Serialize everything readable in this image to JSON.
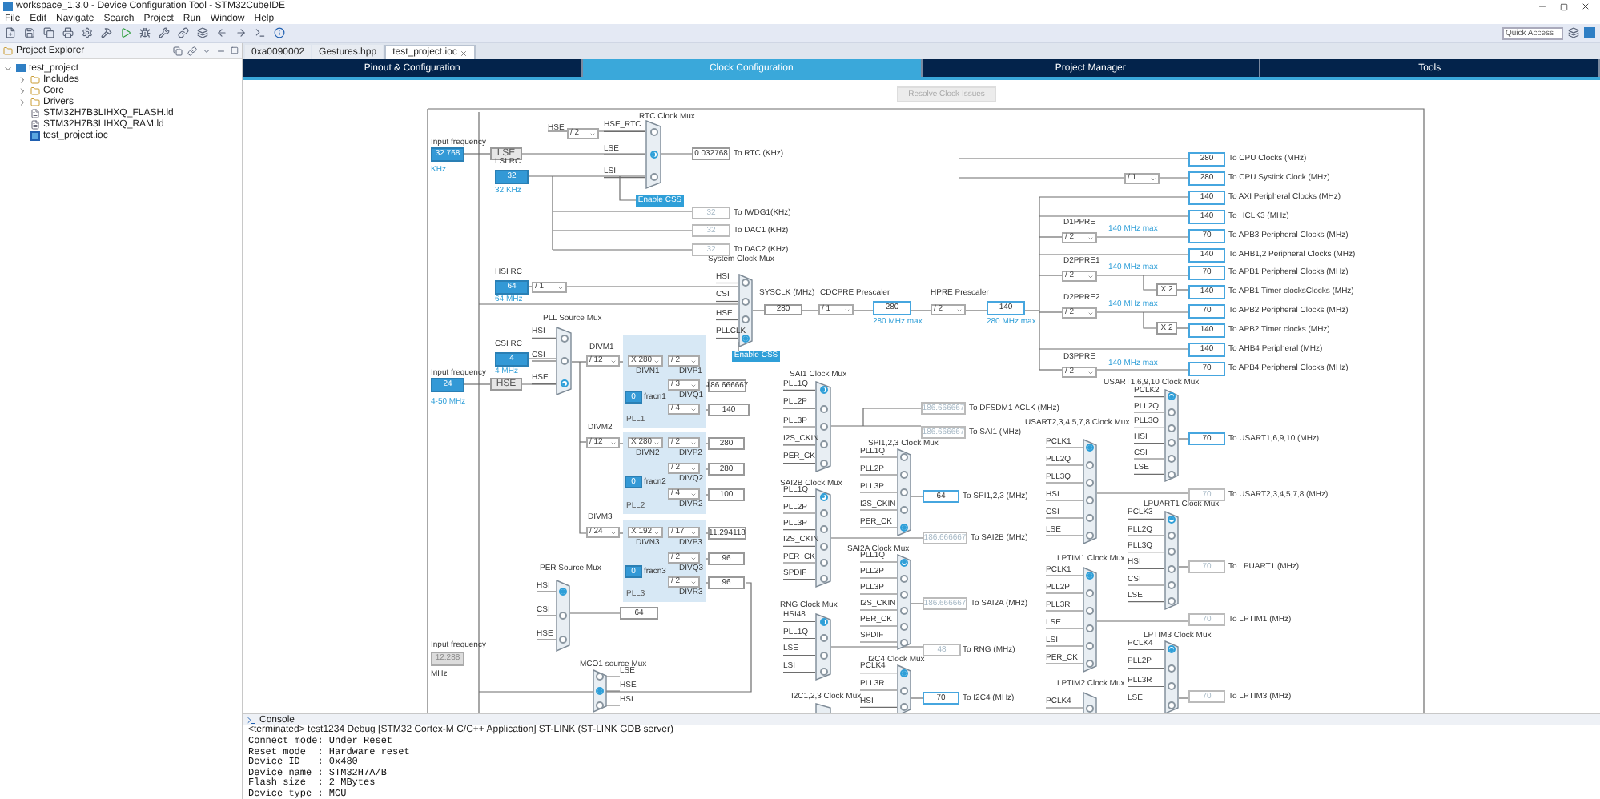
{
  "window": {
    "title": "workspace_1.3.0 - Device Configuration Tool - STM32CubeIDE"
  },
  "menu": [
    "File",
    "Edit",
    "Navigate",
    "Search",
    "Project",
    "Run",
    "Window",
    "Help"
  ],
  "quick_access": {
    "placeholder": "Quick Access"
  },
  "explorer": {
    "title": "Project Explorer",
    "tree": [
      {
        "label": "test_project",
        "kind": "project",
        "expanded": true,
        "children": [
          {
            "label": "Includes",
            "kind": "folder",
            "expanded": false
          },
          {
            "label": "Core",
            "kind": "folder",
            "expanded": false
          },
          {
            "label": "Drivers",
            "kind": "folder",
            "expanded": false
          },
          {
            "label": "STM32H7B3LIHXQ_FLASH.ld",
            "kind": "file"
          },
          {
            "label": "STM32H7B3LIHXQ_RAM.ld",
            "kind": "file"
          },
          {
            "label": "test_project.ioc",
            "kind": "ioc"
          }
        ]
      }
    ]
  },
  "editor_tabs": [
    {
      "label": "0xa0090002",
      "selected": false
    },
    {
      "label": "Gestures.hpp",
      "selected": false
    },
    {
      "label": "test_project.ioc",
      "selected": true
    }
  ],
  "config_tabs": [
    {
      "label": "Pinout & Configuration",
      "selected": false
    },
    {
      "label": "Clock Configuration",
      "selected": true
    },
    {
      "label": "Project Manager",
      "selected": false
    },
    {
      "label": "Tools",
      "selected": false
    }
  ],
  "resolve_button": {
    "label": "Resolve Clock Issues",
    "disabled": true
  },
  "diagram": {
    "items": [
      {
        "kind": "label",
        "text": "Input frequency"
      },
      {
        "kind": "input",
        "text": "32.768"
      },
      {
        "kind": "caption",
        "text": "KHz"
      },
      {
        "kind": "fixed",
        "text": "LSE"
      },
      {
        "kind": "label",
        "text": "LSI RC"
      },
      {
        "kind": "input",
        "text": "32"
      },
      {
        "kind": "caption",
        "text": "32 KHz"
      },
      {
        "kind": "label",
        "text": "HSE"
      },
      {
        "kind": "select",
        "text": "/ 2"
      },
      {
        "kind": "plain",
        "text": "0.032768"
      },
      {
        "kind": "label",
        "text": "To RTC (KHz)"
      },
      {
        "kind": "button",
        "text": "Enable CSS"
      },
      {
        "kind": "dim",
        "text": "32"
      },
      {
        "kind": "label",
        "text": "To IWDG1(KHz)"
      },
      {
        "kind": "dim",
        "text": "32"
      },
      {
        "kind": "label",
        "text": "To DAC1 (KHz)"
      },
      {
        "kind": "dim",
        "text": "32"
      },
      {
        "kind": "label",
        "text": "To DAC2 (KHz)"
      },
      {
        "kind": "label",
        "text": "HSI RC"
      },
      {
        "kind": "input",
        "text": "64"
      },
      {
        "kind": "caption",
        "text": "64 MHz"
      },
      {
        "kind": "select",
        "text": "/ 1"
      },
      {
        "kind": "label",
        "text": "SYSCLK (MHz)"
      },
      {
        "kind": "plain",
        "text": "280"
      },
      {
        "kind": "label",
        "text": "CDCPRE Prescaler"
      },
      {
        "kind": "select",
        "text": "/ 1"
      },
      {
        "kind": "output",
        "text": "280"
      },
      {
        "kind": "caption",
        "text": "280 MHz max"
      },
      {
        "kind": "label",
        "text": "HPRE Prescaler"
      },
      {
        "kind": "select",
        "text": "/ 2"
      },
      {
        "kind": "output",
        "text": "140"
      },
      {
        "kind": "caption",
        "text": "280 MHz max"
      },
      {
        "kind": "button",
        "text": "Enable CSS"
      },
      {
        "kind": "label",
        "text": "CSI RC"
      },
      {
        "kind": "input",
        "text": "4"
      },
      {
        "kind": "label",
        "text": "Input frequency"
      },
      {
        "kind": "caption",
        "text": "4 MHz"
      },
      {
        "kind": "input",
        "text": "24"
      },
      {
        "kind": "caption",
        "text": "4-50 MHz"
      },
      {
        "kind": "fixed",
        "text": "HSE"
      },
      {
        "kind": "panel",
        "text": "PLL1"
      },
      {
        "kind": "panel",
        "text": "PLL2"
      },
      {
        "kind": "panel",
        "text": "PLL3"
      },
      {
        "kind": "label",
        "text": "DIVM1"
      },
      {
        "kind": "select",
        "text": "/ 12"
      },
      {
        "kind": "select",
        "text": "X 280"
      },
      {
        "kind": "label",
        "text": "DIVN1"
      },
      {
        "kind": "select",
        "text": "/ 2"
      },
      {
        "kind": "label",
        "text": "DIVP1"
      },
      {
        "kind": "select",
        "text": "/ 3"
      },
      {
        "kind": "label",
        "text": "DIVQ1"
      },
      {
        "kind": "plain",
        "text": "186.666667"
      },
      {
        "kind": "input",
        "text": "0"
      },
      {
        "kind": "label",
        "text": "fracn1"
      },
      {
        "kind": "select",
        "text": "/ 4"
      },
      {
        "kind": "plain",
        "text": "140"
      },
      {
        "kind": "label",
        "text": "DIVM2"
      },
      {
        "kind": "select",
        "text": "/ 12"
      },
      {
        "kind": "select",
        "text": "X 280"
      },
      {
        "kind": "label",
        "text": "DIVN2"
      },
      {
        "kind": "select",
        "text": "/ 2"
      },
      {
        "kind": "label",
        "text": "DIVP2"
      },
      {
        "kind": "plain",
        "text": "280"
      },
      {
        "kind": "select",
        "text": "/ 2"
      },
      {
        "kind": "label",
        "text": "DIVQ2"
      },
      {
        "kind": "plain",
        "text": "280"
      },
      {
        "kind": "input",
        "text": "0"
      },
      {
        "kind": "label",
        "text": "fracn2"
      },
      {
        "kind": "select",
        "text": "/ 4"
      },
      {
        "kind": "label",
        "text": "DIVR2"
      },
      {
        "kind": "plain",
        "text": "100"
      },
      {
        "kind": "label",
        "text": "DIVM3"
      },
      {
        "kind": "select",
        "text": "/ 24"
      },
      {
        "kind": "select",
        "text": "X 192"
      },
      {
        "kind": "label",
        "text": "DIVN3"
      },
      {
        "kind": "select",
        "text": "/ 17"
      },
      {
        "kind": "label",
        "text": "DIVP3"
      },
      {
        "kind": "plain",
        "text": "11.294118"
      },
      {
        "kind": "select",
        "text": "/ 2"
      },
      {
        "kind": "label",
        "text": "DIVQ3"
      },
      {
        "kind": "plain",
        "text": "96"
      },
      {
        "kind": "input",
        "text": "0"
      },
      {
        "kind": "label",
        "text": "fracn3"
      },
      {
        "kind": "select",
        "text": "/ 2"
      },
      {
        "kind": "label",
        "text": "DIVR3"
      },
      {
        "kind": "plain",
        "text": "96"
      },
      {
        "kind": "plain",
        "text": "64"
      },
      {
        "kind": "label",
        "text": "Input frequency"
      },
      {
        "kind": "dimInput",
        "text": "12.288"
      },
      {
        "kind": "label",
        "text": "MHz"
      },
      {
        "kind": "dim",
        "text": "186.666667"
      },
      {
        "kind": "label",
        "text": "To DFSDM1 ACLK (MHz)"
      },
      {
        "kind": "dim",
        "text": "186.666667"
      },
      {
        "kind": "label",
        "text": "To SAI1 (MHz)"
      },
      {
        "kind": "output",
        "text": "64"
      },
      {
        "kind": "label",
        "text": "To SPI1,2,3 (MHz)"
      },
      {
        "kind": "dim",
        "text": "186.666667"
      },
      {
        "kind": "label",
        "text": "To SAI2B (MHz)"
      },
      {
        "kind": "dim",
        "text": "186.666667"
      },
      {
        "kind": "label",
        "text": "To SAI2A (MHz)"
      },
      {
        "kind": "dim",
        "text": "48"
      },
      {
        "kind": "label",
        "text": "To RNG (MHz)"
      },
      {
        "kind": "output",
        "text": "70"
      },
      {
        "kind": "label",
        "text": "To I2C4 (MHz)"
      },
      {
        "kind": "output",
        "text": "70"
      },
      {
        "kind": "label",
        "text": "To USART1,6,9,10 (MHz)"
      },
      {
        "kind": "dim",
        "text": "70"
      },
      {
        "kind": "label",
        "text": "To USART2,3,4,5,7,8 (MHz)"
      },
      {
        "kind": "dim",
        "text": "70"
      },
      {
        "kind": "label",
        "text": "To LPUART1 (MHz)"
      },
      {
        "kind": "dim",
        "text": "70"
      },
      {
        "kind": "label",
        "text": "To LPTIM1 (MHz)"
      },
      {
        "kind": "dim",
        "text": "70"
      },
      {
        "kind": "label",
        "text": "To LPTIM3 (MHz)"
      },
      {
        "kind": "output",
        "text": "280"
      },
      {
        "kind": "label",
        "text": "To CPU Clocks (MHz)"
      },
      {
        "kind": "output",
        "text": "280"
      },
      {
        "kind": "label",
        "text": "To CPU Systick Clock (MHz)"
      },
      {
        "kind": "output",
        "text": "140"
      },
      {
        "kind": "label",
        "text": "To AXI Peripheral Clocks (MHz)"
      },
      {
        "kind": "output",
        "text": "140"
      },
      {
        "kind": "label",
        "text": "To HCLK3 (MHz)"
      },
      {
        "kind": "output",
        "text": "70"
      },
      {
        "kind": "label",
        "text": "To APB3 Peripheral Clocks (MHz)"
      },
      {
        "kind": "output",
        "text": "140"
      },
      {
        "kind": "label",
        "text": "To AHB1,2 Peripheral Clocks (MHz)"
      },
      {
        "kind": "output",
        "text": "70"
      },
      {
        "kind": "label",
        "text": "To APB1 Peripheral Clocks (MHz)"
      },
      {
        "kind": "output",
        "text": "140"
      },
      {
        "kind": "label",
        "text": "To APB1 Timer clocksClocks (MHz)"
      },
      {
        "kind": "output",
        "text": "70"
      },
      {
        "kind": "label",
        "text": "To APB2 Peripheral Clocks (MHz)"
      },
      {
        "kind": "output",
        "text": "140"
      },
      {
        "kind": "label",
        "text": "To APB2 Timer clocks (MHz)"
      },
      {
        "kind": "output",
        "text": "140"
      },
      {
        "kind": "label",
        "text": "To AHB4 Peripheral (MHz)"
      },
      {
        "kind": "output",
        "text": "70"
      },
      {
        "kind": "label",
        "text": "To APB4 Peripheral Clocks (MHz)"
      },
      {
        "kind": "select",
        "text": "/ 1"
      },
      {
        "kind": "label",
        "text": "D1PPRE"
      },
      {
        "kind": "select",
        "text": "/ 2"
      },
      {
        "kind": "caption",
        "text": "140 MHz max"
      },
      {
        "kind": "label",
        "text": "D2PPRE1"
      },
      {
        "kind": "select",
        "text": "/ 2"
      },
      {
        "kind": "caption",
        "text": "140 MHz max"
      },
      {
        "kind": "label",
        "text": "D2PPRE2"
      },
      {
        "kind": "select",
        "text": "/ 2"
      },
      {
        "kind": "caption",
        "text": "140 MHz max"
      },
      {
        "kind": "label",
        "text": "D3PPRE"
      },
      {
        "kind": "select",
        "text": "/ 2"
      },
      {
        "kind": "caption",
        "text": "140 MHz max"
      },
      {
        "kind": "plain",
        "text": "X 2"
      },
      {
        "kind": "plain",
        "text": "X 2"
      }
    ],
    "muxes": [
      {
        "title": "RTC Clock Mux",
        "inputs": [
          {
            "label": "HSE_RTC",
            "selected": false
          },
          {
            "label": "LSE",
            "selected": true
          },
          {
            "label": "LSI",
            "selected": false
          }
        ]
      },
      {
        "title": "System Clock Mux",
        "inputs": [
          {
            "label": "HSI",
            "selected": false
          },
          {
            "label": "CSI",
            "selected": false
          },
          {
            "label": "HSE",
            "selected": false
          },
          {
            "label": "PLLCLK",
            "selected": true
          }
        ]
      },
      {
        "title": "PLL Source Mux",
        "inputs": [
          {
            "label": "HSI",
            "selected": false
          },
          {
            "label": "CSI",
            "selected": false
          },
          {
            "label": "HSE",
            "selected": true
          }
        ]
      },
      {
        "title": "PER Source Mux",
        "inputs": [
          {
            "label": "HSI",
            "selected": true
          },
          {
            "label": "CSI",
            "selected": false
          },
          {
            "label": "HSE",
            "selected": false
          }
        ]
      },
      {
        "title": "MCO1 source Mux",
        "inputs": [
          {
            "label": "LSE",
            "selected": false
          },
          {
            "label": "HSE",
            "selected": true
          },
          {
            "label": "HSI",
            "selected": false
          }
        ]
      },
      {
        "title": "SAI1 Clock Mux",
        "inputs": [
          {
            "label": "PLL1Q",
            "selected": true
          },
          {
            "label": "PLL2P",
            "selected": false
          },
          {
            "label": "PLL3P",
            "selected": false
          },
          {
            "label": "I2S_CKIN",
            "selected": false
          },
          {
            "label": "PER_CK",
            "selected": false
          }
        ]
      },
      {
        "title": "SPI1,2,3 Clock Mux",
        "inputs": [
          {
            "label": "PLL1Q",
            "selected": false
          },
          {
            "label": "PLL2P",
            "selected": false
          },
          {
            "label": "PLL3P",
            "selected": false
          },
          {
            "label": "I2S_CKIN",
            "selected": false
          },
          {
            "label": "PER_CK",
            "selected": true
          }
        ]
      },
      {
        "title": "SAI2B Clock Mux",
        "inputs": [
          {
            "label": "PLL1Q",
            "selected": true
          },
          {
            "label": "PLL2P",
            "selected": false
          },
          {
            "label": "PLL3P",
            "selected": false
          },
          {
            "label": "I2S_CKIN",
            "selected": false
          },
          {
            "label": "PER_CK",
            "selected": false
          },
          {
            "label": "SPDIF",
            "selected": false
          }
        ]
      },
      {
        "title": "SAI2A Clock Mux",
        "inputs": [
          {
            "label": "PLL1Q",
            "selected": true
          },
          {
            "label": "PLL2P",
            "selected": false
          },
          {
            "label": "PLL3P",
            "selected": false
          },
          {
            "label": "I2S_CKIN",
            "selected": false
          },
          {
            "label": "PER_CK",
            "selected": false
          },
          {
            "label": "SPDIF",
            "selected": false
          }
        ]
      },
      {
        "title": "RNG Clock Mux",
        "inputs": [
          {
            "label": "HSI48",
            "selected": true
          },
          {
            "label": "PLL1Q",
            "selected": false
          },
          {
            "label": "LSE",
            "selected": false
          },
          {
            "label": "LSI",
            "selected": false
          }
        ]
      },
      {
        "title": "I2C4 Clock Mux",
        "inputs": [
          {
            "label": "PCLK4",
            "selected": true
          },
          {
            "label": "PLL3R",
            "selected": false
          },
          {
            "label": "HSI",
            "selected": false
          }
        ]
      },
      {
        "title": "I2C1,2,3 Clock Mux"
      },
      {
        "title": "USART1,6,9,10 Clock Mux",
        "inputs": [
          {
            "label": "PCLK2",
            "selected": true
          },
          {
            "label": "PLL2Q",
            "selected": false
          },
          {
            "label": "PLL3Q",
            "selected": false
          },
          {
            "label": "HSI",
            "selected": false
          },
          {
            "label": "CSI",
            "selected": false
          },
          {
            "label": "LSE",
            "selected": false
          }
        ]
      },
      {
        "title": "USART2,3,4,5,7,8 Clock Mux",
        "inputs": [
          {
            "label": "PCLK1",
            "selected": true
          },
          {
            "label": "PLL2Q",
            "selected": false
          },
          {
            "label": "PLL3Q",
            "selected": false
          },
          {
            "label": "HSI",
            "selected": false
          },
          {
            "label": "CSI",
            "selected": false
          },
          {
            "label": "LSE",
            "selected": false
          }
        ]
      },
      {
        "title": "LPUART1 Clock Mux",
        "inputs": [
          {
            "label": "PCLK3",
            "selected": true
          },
          {
            "label": "PLL2Q",
            "selected": false
          },
          {
            "label": "PLL3Q",
            "selected": false
          },
          {
            "label": "HSI",
            "selected": false
          },
          {
            "label": "CSI",
            "selected": false
          },
          {
            "label": "LSE",
            "selected": false
          }
        ]
      },
      {
        "title": "LPTIM1 Clock Mux",
        "inputs": [
          {
            "label": "PCLK1",
            "selected": true
          },
          {
            "label": "PLL2P",
            "selected": false
          },
          {
            "label": "PLL3R",
            "selected": false
          },
          {
            "label": "LSE",
            "selected": false
          },
          {
            "label": "LSI",
            "selected": false
          },
          {
            "label": "PER_CK",
            "selected": false
          }
        ]
      },
      {
        "title": "LPTIM2 Clock Mux",
        "inputs": [
          {
            "label": "PCLK4",
            "selected": false
          }
        ]
      },
      {
        "title": "LPTIM3 Clock Mux",
        "inputs": [
          {
            "label": "PCLK4",
            "selected": true
          },
          {
            "label": "PLL2P",
            "selected": false
          },
          {
            "label": "PLL3R",
            "selected": false
          },
          {
            "label": "LSE",
            "selected": false
          }
        ]
      }
    ]
  },
  "console": {
    "title": "Console",
    "header": "<terminated> test1234 Debug [STM32 Cortex-M C/C++ Application] ST-LINK (ST-LINK GDB server)",
    "lines": [
      "Connect mode: Under Reset",
      "Reset mode  : Hardware reset",
      "Device ID   : 0x480",
      "Device name : STM32H7A/B",
      "Flash size  : 2 MBytes",
      "Device type : MCU"
    ]
  }
}
